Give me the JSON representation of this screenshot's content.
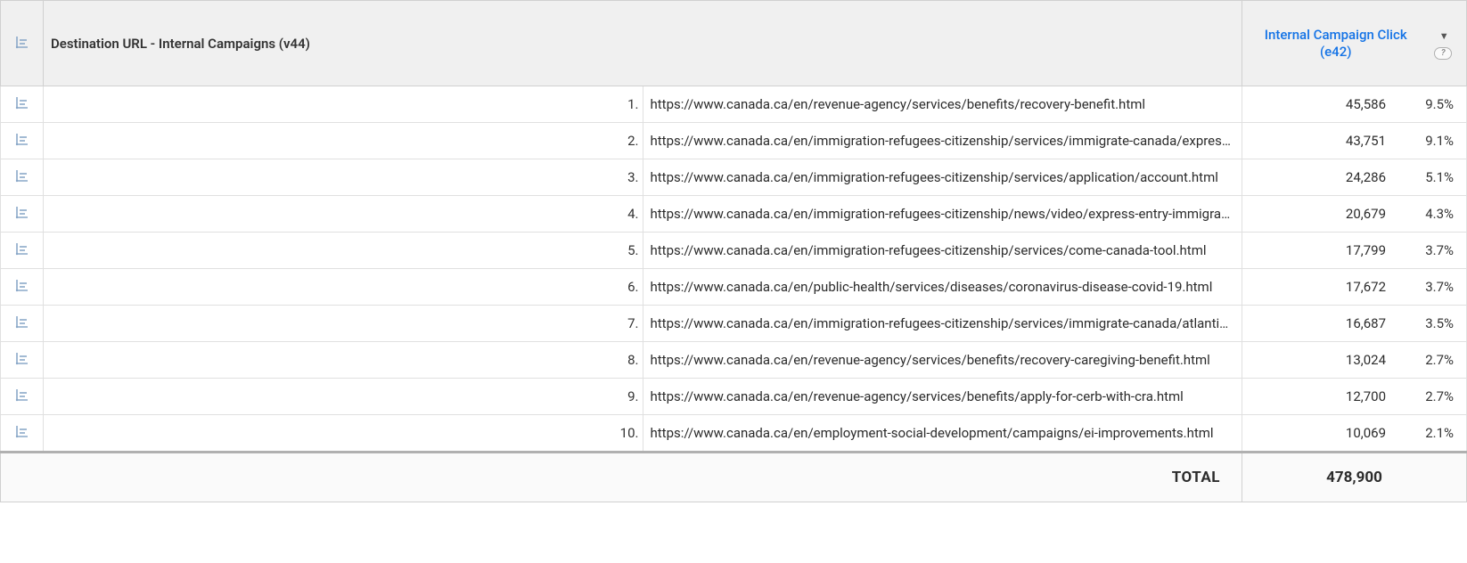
{
  "header": {
    "dimension_label": "Destination URL - Internal Campaigns (v44)",
    "metric_label": "Internal Campaign Click (e42)",
    "sort_indicator": "▼",
    "help_glyph": "?"
  },
  "rows": [
    {
      "rank": "1.",
      "url": "https://www.canada.ca/en/revenue-agency/services/benefits/recovery-benefit.html",
      "value": "45,586",
      "pct": "9.5%"
    },
    {
      "rank": "2.",
      "url": "https://www.canada.ca/en/immigration-refugees-citizenship/services/immigrate-canada/express-entry.html",
      "value": "43,751",
      "pct": "9.1%"
    },
    {
      "rank": "3.",
      "url": "https://www.canada.ca/en/immigration-refugees-citizenship/services/application/account.html",
      "value": "24,286",
      "pct": "5.1%"
    },
    {
      "rank": "4.",
      "url": "https://www.canada.ca/en/immigration-refugees-citizenship/news/video/express-entry-immigrate-canada-skilled-worker.html",
      "value": "20,679",
      "pct": "4.3%"
    },
    {
      "rank": "5.",
      "url": "https://www.canada.ca/en/immigration-refugees-citizenship/services/come-canada-tool.html",
      "value": "17,799",
      "pct": "3.7%"
    },
    {
      "rank": "6.",
      "url": "https://www.canada.ca/en/public-health/services/diseases/coronavirus-disease-covid-19.html",
      "value": "17,672",
      "pct": "3.7%"
    },
    {
      "rank": "7.",
      "url": "https://www.canada.ca/en/immigration-refugees-citizenship/services/immigrate-canada/atlantic-immigration-pilot/hire-immigrant.html",
      "value": "16,687",
      "pct": "3.5%"
    },
    {
      "rank": "8.",
      "url": "https://www.canada.ca/en/revenue-agency/services/benefits/recovery-caregiving-benefit.html",
      "value": "13,024",
      "pct": "2.7%"
    },
    {
      "rank": "9.",
      "url": "https://www.canada.ca/en/revenue-agency/services/benefits/apply-for-cerb-with-cra.html",
      "value": "12,700",
      "pct": "2.7%"
    },
    {
      "rank": "10.",
      "url": "https://www.canada.ca/en/employment-social-development/campaigns/ei-improvements.html",
      "value": "10,069",
      "pct": "2.1%"
    }
  ],
  "total": {
    "label": "TOTAL",
    "value": "478,900"
  }
}
